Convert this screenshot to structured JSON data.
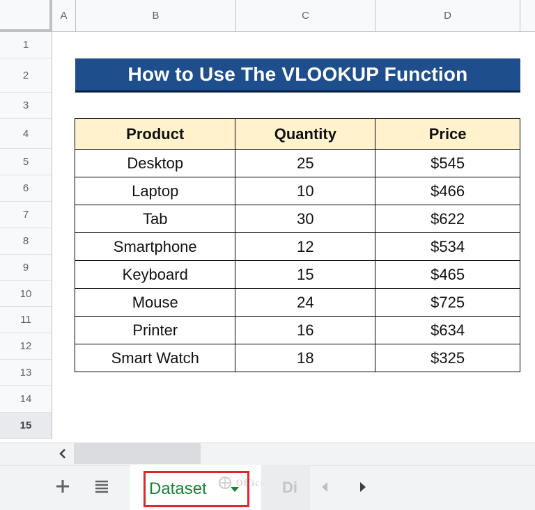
{
  "columns": [
    "A",
    "B",
    "C",
    "D"
  ],
  "rows": [
    "1",
    "2",
    "3",
    "4",
    "5",
    "6",
    "7",
    "8",
    "9",
    "10",
    "11",
    "12",
    "13",
    "14",
    "15"
  ],
  "title": "How to Use The VLOOKUP Function",
  "table": {
    "headers": [
      "Product",
      "Quantity",
      "Price"
    ],
    "rows": [
      [
        "Desktop",
        "25",
        "$545"
      ],
      [
        "Laptop",
        "10",
        "$466"
      ],
      [
        "Tab",
        "30",
        "$622"
      ],
      [
        "Smartphone",
        "12",
        "$534"
      ],
      [
        "Keyboard",
        "15",
        "$465"
      ],
      [
        "Mouse",
        "24",
        "$725"
      ],
      [
        "Printer",
        "16",
        "$634"
      ],
      [
        "Smart Watch",
        "18",
        "$325"
      ]
    ]
  },
  "sheet_tabs": {
    "active": "Dataset",
    "next_partial": "Di",
    "watermark": "OfficeWheel"
  },
  "icons": {
    "add_sheet": "plus-icon",
    "all_sheets": "menu-icon",
    "tab_menu": "dropdown-arrow-icon",
    "scroll_left": "chevron-left-icon",
    "scroll_right": "chevron-right-icon"
  },
  "colors": {
    "title_bg": "#1f4e8c",
    "header_bg": "#fff2cc",
    "active_tab_text": "#188038",
    "highlight_box": "#e0262a"
  }
}
